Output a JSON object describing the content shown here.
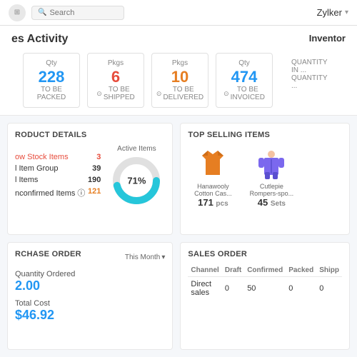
{
  "nav": {
    "search_placeholder": "Search",
    "company_name": "Zylker",
    "logo_icon": "app-icon"
  },
  "page": {
    "title": "es Activity",
    "inventory_label": "Inventor"
  },
  "stats": [
    {
      "number": "228",
      "unit": "Qty",
      "desc": "TO BE PACKED",
      "color": "blue",
      "icon": ""
    },
    {
      "number": "6",
      "unit": "Pkgs",
      "desc": "TO BE SHIPPED",
      "color": "red",
      "icon": "⊙"
    },
    {
      "number": "10",
      "unit": "Pkgs",
      "desc": "TO BE DELIVERED",
      "color": "orange",
      "icon": "⊙"
    },
    {
      "number": "474",
      "unit": "Qty",
      "desc": "TO BE INVOICED",
      "color": "blue",
      "icon": "⊙"
    }
  ],
  "inventory_side": {
    "line1": "QUANTITY IN ...",
    "line2": "QUANTITY ..."
  },
  "product_details": {
    "title": "RODUCT DETAILS",
    "rows": [
      {
        "label": "ow Stock Items",
        "value": "3",
        "label_color": "red",
        "value_color": "red"
      },
      {
        "label": "l Item Group",
        "value": "39",
        "label_color": "black",
        "value_color": "black"
      },
      {
        "label": "l Items",
        "value": "190",
        "label_color": "black",
        "value_color": "black"
      },
      {
        "label": "nconfirmed Items ⓘ",
        "value": "121",
        "label_color": "black",
        "value_color": "orange"
      }
    ],
    "donut": {
      "label": "Active Items",
      "percentage": "71%",
      "value": 71,
      "color_filled": "#26c6da",
      "color_empty": "#e0e0e0"
    }
  },
  "top_selling": {
    "title": "TOP SELLING ITEMS",
    "items": [
      {
        "name": "Hanawooly Cotton Cas...",
        "qty": "171",
        "unit": "pcs",
        "color": "#e67e22"
      },
      {
        "name": "Cutlepie Rompers-spo...",
        "qty": "45",
        "unit": "Sets",
        "color": "#7b68ee"
      }
    ]
  },
  "purchase_order": {
    "title": "RCHASE ORDER",
    "period": "This Month",
    "qty_label": "Quantity Ordered",
    "qty_value": "2.00",
    "cost_label": "Total Cost",
    "cost_value": "$46.92"
  },
  "sales_order": {
    "title": "SALES ORDER",
    "columns": [
      "Channel",
      "Draft",
      "Confirmed",
      "Packed",
      "Shipp"
    ],
    "rows": [
      {
        "channel": "Direct sales",
        "draft": "0",
        "confirmed": "50",
        "packed": "0",
        "shipped": "0"
      }
    ]
  }
}
